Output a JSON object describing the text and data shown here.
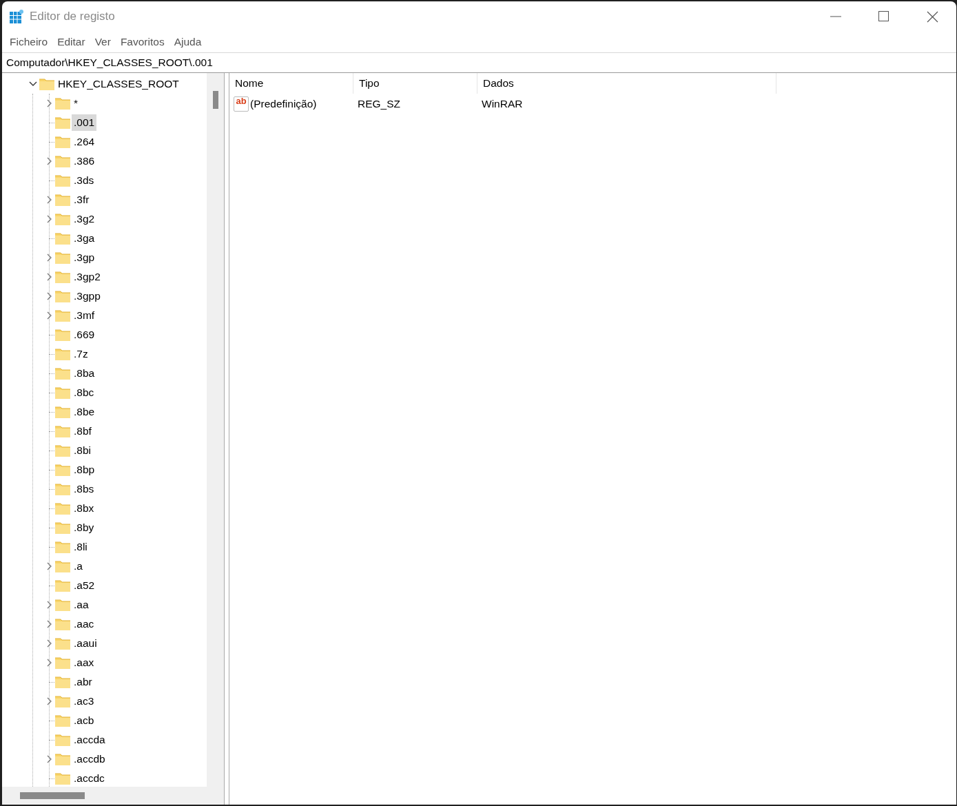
{
  "window": {
    "title": "Editor de registo"
  },
  "menu": [
    "Ficheiro",
    "Editar",
    "Ver",
    "Favoritos",
    "Ajuda"
  ],
  "address": "Computador\\HKEY_CLASSES_ROOT\\.001",
  "tree": {
    "label": "HKEY_CLASSES_ROOT",
    "expanded": true,
    "selected": false,
    "children": [
      {
        "label": "*",
        "expandable": true,
        "selected": false
      },
      {
        "label": ".001",
        "expandable": false,
        "selected": true
      },
      {
        "label": ".264",
        "expandable": false,
        "selected": false
      },
      {
        "label": ".386",
        "expandable": true,
        "selected": false
      },
      {
        "label": ".3ds",
        "expandable": false,
        "selected": false
      },
      {
        "label": ".3fr",
        "expandable": true,
        "selected": false
      },
      {
        "label": ".3g2",
        "expandable": true,
        "selected": false
      },
      {
        "label": ".3ga",
        "expandable": false,
        "selected": false
      },
      {
        "label": ".3gp",
        "expandable": true,
        "selected": false
      },
      {
        "label": ".3gp2",
        "expandable": true,
        "selected": false
      },
      {
        "label": ".3gpp",
        "expandable": true,
        "selected": false
      },
      {
        "label": ".3mf",
        "expandable": true,
        "selected": false
      },
      {
        "label": ".669",
        "expandable": false,
        "selected": false
      },
      {
        "label": ".7z",
        "expandable": false,
        "selected": false
      },
      {
        "label": ".8ba",
        "expandable": false,
        "selected": false
      },
      {
        "label": ".8bc",
        "expandable": false,
        "selected": false
      },
      {
        "label": ".8be",
        "expandable": false,
        "selected": false
      },
      {
        "label": ".8bf",
        "expandable": false,
        "selected": false
      },
      {
        "label": ".8bi",
        "expandable": false,
        "selected": false
      },
      {
        "label": ".8bp",
        "expandable": false,
        "selected": false
      },
      {
        "label": ".8bs",
        "expandable": false,
        "selected": false
      },
      {
        "label": ".8bx",
        "expandable": false,
        "selected": false
      },
      {
        "label": ".8by",
        "expandable": false,
        "selected": false
      },
      {
        "label": ".8li",
        "expandable": false,
        "selected": false
      },
      {
        "label": ".a",
        "expandable": true,
        "selected": false
      },
      {
        "label": ".a52",
        "expandable": false,
        "selected": false
      },
      {
        "label": ".aa",
        "expandable": true,
        "selected": false
      },
      {
        "label": ".aac",
        "expandable": true,
        "selected": false
      },
      {
        "label": ".aaui",
        "expandable": true,
        "selected": false
      },
      {
        "label": ".aax",
        "expandable": true,
        "selected": false
      },
      {
        "label": ".abr",
        "expandable": false,
        "selected": false
      },
      {
        "label": ".ac3",
        "expandable": true,
        "selected": false
      },
      {
        "label": ".acb",
        "expandable": false,
        "selected": false
      },
      {
        "label": ".accda",
        "expandable": false,
        "selected": false
      },
      {
        "label": ".accdb",
        "expandable": true,
        "selected": false
      },
      {
        "label": ".accdc",
        "expandable": false,
        "selected": false
      }
    ]
  },
  "table": {
    "columns": [
      "Nome",
      "Tipo",
      "Dados"
    ],
    "rows": [
      {
        "icon_text": "ab",
        "cells": [
          "(Predefinição)",
          "REG_SZ",
          "WinRAR"
        ]
      }
    ]
  }
}
